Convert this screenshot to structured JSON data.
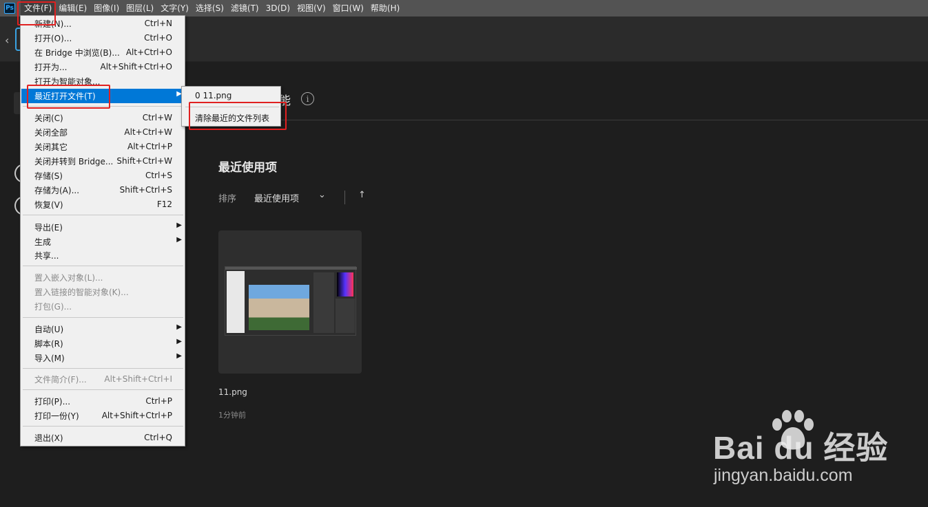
{
  "menubar": {
    "logo": "Ps",
    "items": [
      "文件(F)",
      "编辑(E)",
      "图像(I)",
      "图层(L)",
      "文字(Y)",
      "选择(S)",
      "滤镜(T)",
      "3D(D)",
      "视图(V)",
      "窗口(W)",
      "帮助(H)"
    ]
  },
  "file_menu": {
    "items": [
      {
        "label": "新建(N)...",
        "shortcut": "Ctrl+N"
      },
      {
        "label": "打开(O)...",
        "shortcut": "Ctrl+O"
      },
      {
        "label": "在 Bridge 中浏览(B)...",
        "shortcut": "Alt+Ctrl+O"
      },
      {
        "label": "打开为...",
        "shortcut": "Alt+Shift+Ctrl+O"
      },
      {
        "label": "打开为智能对象...",
        "shortcut": ""
      },
      {
        "label": "最近打开文件(T)",
        "shortcut": ""
      },
      {
        "label": "关闭(C)",
        "shortcut": "Ctrl+W"
      },
      {
        "label": "关闭全部",
        "shortcut": "Alt+Ctrl+W"
      },
      {
        "label": "关闭其它",
        "shortcut": "Alt+Ctrl+P"
      },
      {
        "label": "关闭并转到 Bridge...",
        "shortcut": "Shift+Ctrl+W"
      },
      {
        "label": "存储(S)",
        "shortcut": "Ctrl+S"
      },
      {
        "label": "存储为(A)...",
        "shortcut": "Shift+Ctrl+S"
      },
      {
        "label": "恢复(V)",
        "shortcut": "F12"
      },
      {
        "label": "导出(E)",
        "shortcut": ""
      },
      {
        "label": "生成",
        "shortcut": ""
      },
      {
        "label": "共享...",
        "shortcut": ""
      },
      {
        "label": "置入嵌入对象(L)...",
        "shortcut": ""
      },
      {
        "label": "置入链接的智能对象(K)...",
        "shortcut": ""
      },
      {
        "label": "打包(G)...",
        "shortcut": ""
      },
      {
        "label": "自动(U)",
        "shortcut": ""
      },
      {
        "label": "脚本(R)",
        "shortcut": ""
      },
      {
        "label": "导入(M)",
        "shortcut": ""
      },
      {
        "label": "文件简介(F)...",
        "shortcut": "Alt+Shift+Ctrl+I"
      },
      {
        "label": "打印(P)...",
        "shortcut": "Ctrl+P"
      },
      {
        "label": "打印一份(Y)",
        "shortcut": "Alt+Shift+Ctrl+P"
      },
      {
        "label": "退出(X)",
        "shortcut": "Ctrl+Q"
      }
    ]
  },
  "recent_submenu": {
    "file_entry": "0  11.png",
    "clear_list": "清除最近的文件列表"
  },
  "home": {
    "heading_tail": "能",
    "recent_title": "最近使用项",
    "sort_label": "排序",
    "sort_value": "最近使用项",
    "file": {
      "name": "11.png",
      "time": "1分钟前"
    }
  },
  "icons": {
    "back": "‹",
    "info": "i",
    "chevron_down": "⌄",
    "sort_up": "↑",
    "submenu_arrow": "▶"
  },
  "watermark": {
    "logo_text": "Bai  du 经验",
    "url": "jingyan.baidu.com"
  },
  "colors": {
    "highlight": "#0078d7",
    "annotation": "#e02020",
    "menubar": "#535353",
    "background": "#1e1e1e"
  }
}
